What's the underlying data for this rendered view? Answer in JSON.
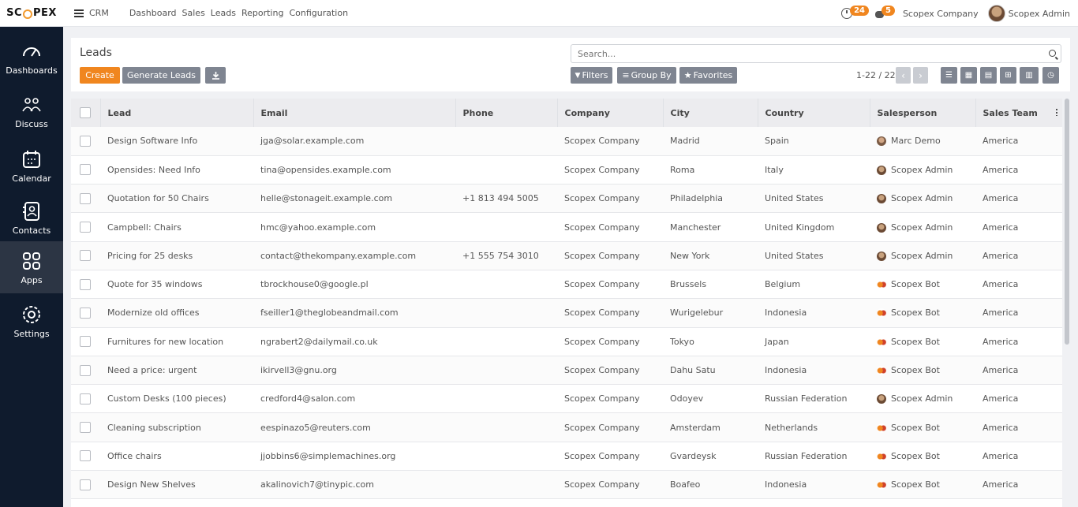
{
  "topbar": {
    "logo": "SCOPEX",
    "app": "CRM",
    "nav": [
      "Dashboard",
      "Sales",
      "Leads",
      "Reporting",
      "Configuration"
    ],
    "activity_count": "24",
    "message_count": "5",
    "company": "Scopex Company",
    "user": "Scopex Admin"
  },
  "sidebar": {
    "items": [
      {
        "label": "Dashboards",
        "icon": "gauge-icon"
      },
      {
        "label": "Discuss",
        "icon": "discuss-icon"
      },
      {
        "label": "Calendar",
        "icon": "calendar-icon"
      },
      {
        "label": "Contacts",
        "icon": "contacts-icon"
      },
      {
        "label": "Apps",
        "icon": "apps-grid-icon"
      },
      {
        "label": "Settings",
        "icon": "gear-icon"
      }
    ]
  },
  "control": {
    "title": "Leads",
    "create": "Create",
    "generate": "Generate Leads",
    "search_placeholder": "Search...",
    "filters": "Filters",
    "group_by": "Group By",
    "favorites": "Favorites",
    "pager": "1-22 / 22"
  },
  "table": {
    "columns": [
      "Lead",
      "Email",
      "Phone",
      "Company",
      "City",
      "Country",
      "Salesperson",
      "Sales Team"
    ],
    "rows": [
      {
        "lead": "Design Software Info",
        "email": "jga@solar.example.com",
        "phone": "",
        "company": "Scopex Company",
        "city": "Madrid",
        "country": "Spain",
        "salesperson": "Marc Demo",
        "sp_type": "demo",
        "team": "America"
      },
      {
        "lead": "Opensides: Need Info",
        "email": "tina@opensides.example.com",
        "phone": "",
        "company": "Scopex Company",
        "city": "Roma",
        "country": "Italy",
        "salesperson": "Scopex Admin",
        "sp_type": "admin",
        "team": "America"
      },
      {
        "lead": "Quotation for 50 Chairs",
        "email": "helle@stonageit.example.com",
        "phone": "+1 813 494 5005",
        "company": "Scopex Company",
        "city": "Philadelphia",
        "country": "United States",
        "salesperson": "Scopex Admin",
        "sp_type": "admin",
        "team": "America"
      },
      {
        "lead": "Campbell: Chairs",
        "email": "hmc@yahoo.example.com",
        "phone": "",
        "company": "Scopex Company",
        "city": "Manchester",
        "country": "United Kingdom",
        "salesperson": "Scopex Admin",
        "sp_type": "admin",
        "team": "America"
      },
      {
        "lead": "Pricing for 25 desks",
        "email": "contact@thekompany.example.com",
        "phone": "+1 555 754 3010",
        "company": "Scopex Company",
        "city": "New York",
        "country": "United States",
        "salesperson": "Scopex Admin",
        "sp_type": "admin",
        "team": "America"
      },
      {
        "lead": "Quote for 35 windows",
        "email": "tbrockhouse0@google.pl",
        "phone": "",
        "company": "Scopex Company",
        "city": "Brussels",
        "country": "Belgium",
        "salesperson": "Scopex Bot",
        "sp_type": "bot",
        "team": "America"
      },
      {
        "lead": "Modernize old offices",
        "email": "fseiller1@theglobeandmail.com",
        "phone": "",
        "company": "Scopex Company",
        "city": "Wurigelebur",
        "country": "Indonesia",
        "salesperson": "Scopex Bot",
        "sp_type": "bot",
        "team": "America"
      },
      {
        "lead": "Furnitures for new location",
        "email": "ngrabert2@dailymail.co.uk",
        "phone": "",
        "company": "Scopex Company",
        "city": "Tokyo",
        "country": "Japan",
        "salesperson": "Scopex Bot",
        "sp_type": "bot",
        "team": "America"
      },
      {
        "lead": "Need a price: urgent",
        "email": "ikirvell3@gnu.org",
        "phone": "",
        "company": "Scopex Company",
        "city": "Dahu Satu",
        "country": "Indonesia",
        "salesperson": "Scopex Bot",
        "sp_type": "bot",
        "team": "America"
      },
      {
        "lead": "Custom Desks (100 pieces)",
        "email": "credford4@salon.com",
        "phone": "",
        "company": "Scopex Company",
        "city": "Odoyev",
        "country": "Russian Federation",
        "salesperson": "Scopex Admin",
        "sp_type": "admin",
        "team": "America"
      },
      {
        "lead": "Cleaning subscription",
        "email": "eespinazo5@reuters.com",
        "phone": "",
        "company": "Scopex Company",
        "city": "Amsterdam",
        "country": "Netherlands",
        "salesperson": "Scopex Bot",
        "sp_type": "bot",
        "team": "America"
      },
      {
        "lead": "Office chairs",
        "email": "jjobbins6@simplemachines.org",
        "phone": "",
        "company": "Scopex Company",
        "city": "Gvardeysk",
        "country": "Russian Federation",
        "salesperson": "Scopex Bot",
        "sp_type": "bot",
        "team": "America"
      },
      {
        "lead": "Design New Shelves",
        "email": "akalinovich7@tinypic.com",
        "phone": "",
        "company": "Scopex Company",
        "city": "Boafeo",
        "country": "Indonesia",
        "salesperson": "Scopex Bot",
        "sp_type": "bot",
        "team": "America"
      }
    ]
  }
}
